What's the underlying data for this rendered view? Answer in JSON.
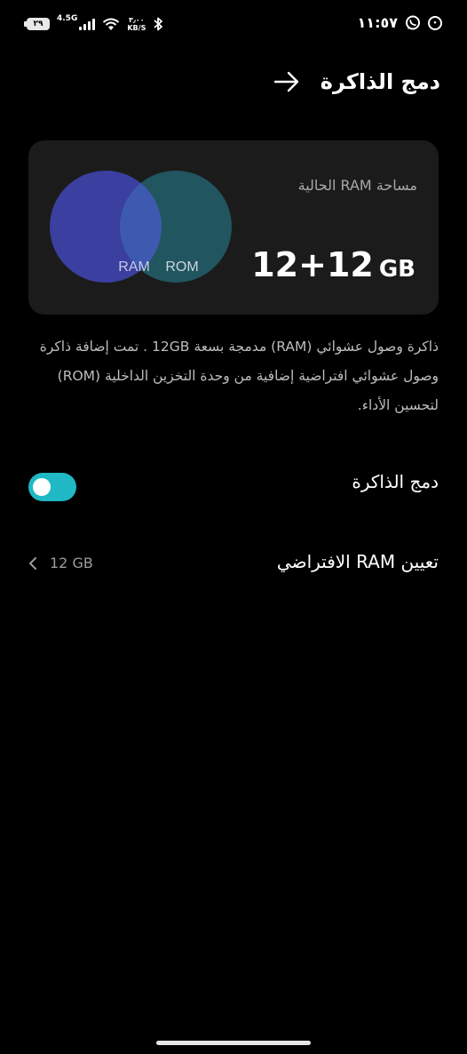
{
  "status_bar": {
    "time": "١١:٥٧",
    "battery": "٢٩",
    "network": "4.5G",
    "speed_value": "٣٫٠٠",
    "speed_unit": "KB/S",
    "icon_names": [
      "battery-icon",
      "signal-icon",
      "wifi-icon",
      "bluetooth-icon",
      "whatsapp-icon",
      "notification-icon"
    ]
  },
  "header": {
    "title": "دمج الذاكرة",
    "back_icon": "arrow-right-icon"
  },
  "ram_card": {
    "label": "مساحة RAM الحالية",
    "value": "12+12",
    "unit": "GB",
    "venn_left": "RAM",
    "venn_right": "ROM",
    "colors": {
      "ram": "#3a3fa0",
      "rom": "#215560",
      "overlap": "#3e59b0"
    }
  },
  "description": "ذاكرة وصول عشوائي (RAM) مدمجة بسعة 12GB . تمت إضافة ذاكرة وصول عشوائي افتراضية إضافية من وحدة التخزين الداخلية (ROM) لتحسين الأداء.",
  "settings": {
    "merge_memory": {
      "label": "دمج الذاكرة",
      "enabled": true,
      "accent": "#1fb8c4"
    },
    "virtual_ram": {
      "label": "تعيين RAM الافتراضي",
      "value": "12 GB"
    }
  }
}
